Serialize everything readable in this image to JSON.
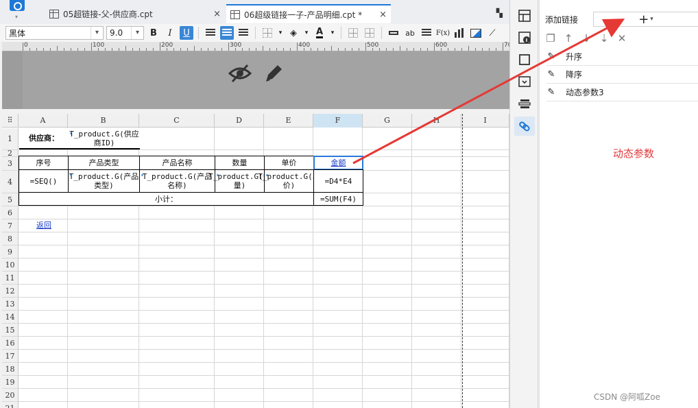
{
  "tabs": [
    {
      "label": "05超链接-父-供应商.cpt",
      "close": "×"
    },
    {
      "label": "06超级链接一子-产品明细.cpt *",
      "close": "×"
    }
  ],
  "toolbar": {
    "font": "黑体",
    "size": "9.0",
    "bold": "B",
    "italic": "I",
    "underline": "U",
    "text_color": "A",
    "ab_label": "ab",
    "fx_label": "F(x)"
  },
  "ruler": {
    "labels": [
      "0",
      "100",
      "200",
      "300",
      "400",
      "500",
      "600",
      "70"
    ]
  },
  "grid": {
    "columns": [
      "A",
      "B",
      "C",
      "D",
      "E",
      "F",
      "G",
      "H",
      "I"
    ],
    "rows": [
      "1",
      "2",
      "3",
      "4",
      "5",
      "6",
      "7",
      "8",
      "9",
      "10",
      "11",
      "12",
      "13",
      "14",
      "15",
      "16",
      "17",
      "18",
      "19",
      "20",
      "21"
    ],
    "cells": {
      "a1": "供应商：",
      "b1": "T_product.G(供应商ID)",
      "a3": "序号",
      "b3": "产品类型",
      "c3": "产品名称",
      "d3": "数量",
      "e3": "单价",
      "f3": "金额",
      "a4": "=SEQ()",
      "b4": "T_product.G(产品类型)",
      "c4": "T_product.G(产品名称)",
      "d4": "T_product.G(数量)",
      "e4": "T_product.G(单价)",
      "f4": "=D4*E4",
      "a5": "小计：",
      "f5": "=SUM(F4)",
      "a7": "返回"
    }
  },
  "panel": {
    "title": "添加链接",
    "add": "+",
    "items": [
      {
        "label": "升序"
      },
      {
        "label": "降序"
      },
      {
        "label": "动态参数3"
      }
    ]
  },
  "annotation": "动态参数",
  "watermark": "CSDN @阿呱Zoe",
  "colors": {
    "accent": "#1e78d7",
    "annotation": "#e0393c",
    "link": "#1a3cc8"
  }
}
